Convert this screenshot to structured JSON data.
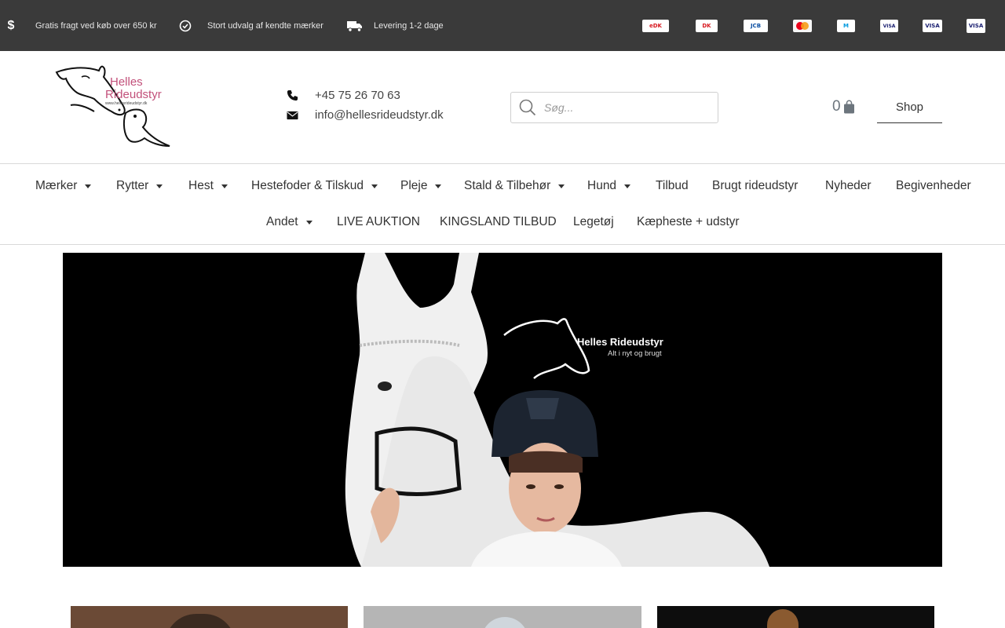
{
  "topbar": {
    "usps": [
      {
        "icon": "dollar-icon",
        "text": "Gratis fragt ved køb over 650 kr"
      },
      {
        "icon": "check-circle-icon",
        "text": "Stort udvalg af kendte mærker"
      },
      {
        "icon": "truck-icon",
        "text": "Levering 1-2 dage"
      }
    ],
    "payment_methods": [
      {
        "name": "eDankort",
        "label": "eDK",
        "color": "#d71920"
      },
      {
        "name": "Dankort",
        "label": "DK",
        "color": "#d71920"
      },
      {
        "name": "JCB",
        "label": "JCB",
        "color": "#0b4ea2"
      },
      {
        "name": "Mastercard",
        "label": "MC",
        "color": "#eb001b"
      },
      {
        "name": "Maestro",
        "label": "M",
        "color": "#0099df"
      },
      {
        "name": "VISA Electron",
        "label": "VISA",
        "color": "#1a1f71"
      },
      {
        "name": "VISA",
        "label": "VISA",
        "color": "#1a1f71"
      },
      {
        "name": "VISA Electron 2",
        "label": "VISA",
        "color": "#1a1f71"
      }
    ]
  },
  "header": {
    "logo": {
      "line1": "Helles",
      "line2": "Rideudstyr",
      "url_text": "www.hellesrideudstyr.dk"
    },
    "phone": "+45 75 26 70 63",
    "email": "info@hellesrideudstyr.dk",
    "search_placeholder": "Søg...",
    "cart_count": "0",
    "shop_label": "Shop"
  },
  "nav": {
    "row1": [
      {
        "label": "Mærker",
        "dropdown": true
      },
      {
        "label": "Rytter",
        "dropdown": true
      },
      {
        "label": "Hest",
        "dropdown": true
      },
      {
        "label": "Hestefoder & Tilskud",
        "dropdown": true
      },
      {
        "label": "Pleje",
        "dropdown": true
      },
      {
        "label": "Stald & Tilbehør",
        "dropdown": true
      },
      {
        "label": "Hund",
        "dropdown": true
      },
      {
        "label": "Tilbud",
        "dropdown": false
      },
      {
        "label": "Brugt rideudstyr",
        "dropdown": false
      },
      {
        "label": "Nyheder",
        "dropdown": false
      },
      {
        "label": "Begivenheder",
        "dropdown": false
      }
    ],
    "row2": [
      {
        "label": "Andet",
        "dropdown": true
      },
      {
        "label": "LIVE AUKTION",
        "dropdown": false
      },
      {
        "label": "KINGSLAND TILBUD",
        "dropdown": false
      },
      {
        "label": "Legetøj",
        "dropdown": false
      },
      {
        "label": "Kæpheste + udstyr",
        "dropdown": false
      }
    ]
  },
  "hero": {
    "brand": "Helles Rideudstyr",
    "tagline": "Alt i nyt og brugt"
  },
  "colors": {
    "topbar_bg": "#3a3a3a",
    "logo_pink": "#c2507a",
    "hero_bg": "#000000"
  }
}
